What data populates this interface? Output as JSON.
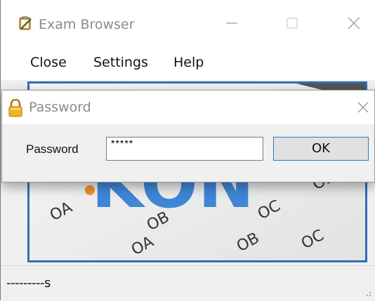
{
  "window": {
    "title": "Exam Browser",
    "icon": "clipboard-pencil-icon",
    "controls": [
      "minimize-icon",
      "maximize-icon",
      "close-icon"
    ]
  },
  "menubar": {
    "items": [
      {
        "label": "Close"
      },
      {
        "label": "Settings"
      },
      {
        "label": "Help"
      }
    ]
  },
  "content": {
    "banner_text": "KON",
    "sheet_marks": [
      "OA",
      "OB",
      "OC",
      "OD",
      "OA",
      "OB",
      "OC"
    ]
  },
  "dialog": {
    "title": "Password",
    "icon": "lock-icon",
    "field_label": "Password",
    "password_value": "*****",
    "ok_label": "OK"
  },
  "statusbar": {
    "text": "---------s"
  },
  "colors": {
    "accent": "#2f6fb7",
    "banner_blue": "#3f86d6",
    "banner_orange": "#f0922a"
  }
}
